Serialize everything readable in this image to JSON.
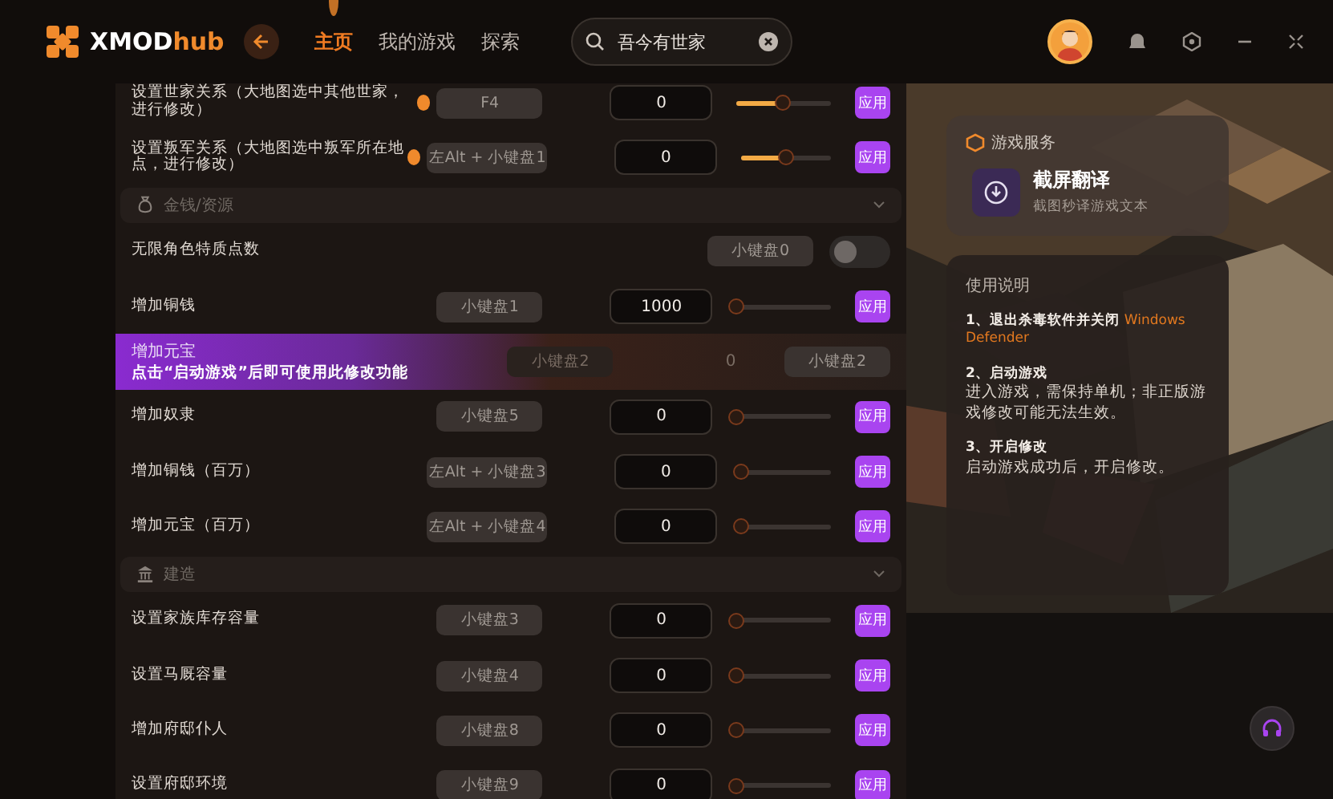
{
  "header": {
    "brand_main": "XMOD",
    "brand_accent": "hub",
    "nav": [
      {
        "label": "主页",
        "selected": true
      },
      {
        "label": "我的游戏",
        "selected": false
      },
      {
        "label": "探索",
        "selected": false
      }
    ],
    "search": {
      "value": "吾今有世家"
    }
  },
  "sections": [
    {
      "rows": [
        {
          "kind": "slider",
          "label": "设置世家关系（大地图选中其他世家，进行修改）",
          "info": true,
          "key": "F4",
          "value": "0",
          "level": 0.5,
          "button": "应用"
        },
        {
          "kind": "slider",
          "label": "设置叛军关系（大地图选中叛军所在地点，进行修改）",
          "info": true,
          "key": "左Alt + 小键盘1",
          "value": "0",
          "level": 0.5,
          "button": "应用"
        }
      ]
    },
    {
      "title": "金钱/资源",
      "rows": [
        {
          "kind": "toggle",
          "label": "无限角色特质点数",
          "key": "小键盘0",
          "on": false
        },
        {
          "kind": "slider",
          "label": "增加铜钱",
          "info": false,
          "key": "小键盘1",
          "value": "1000",
          "level": 0,
          "button": "应用"
        },
        {
          "kind": "locked",
          "label": "增加元宝",
          "notice": "点击“启动游戏”后即可使用此修改功能",
          "key": "小键盘2",
          "value": "0",
          "key2": "小键盘2"
        },
        {
          "kind": "slider",
          "label": "增加奴隶",
          "info": false,
          "key": "小键盘5",
          "value": "0",
          "level": 0,
          "button": "应用"
        },
        {
          "kind": "slider",
          "label": "增加铜钱（百万）",
          "info": false,
          "key": "左Alt + 小键盘3",
          "value": "0",
          "level": 0,
          "button": "应用"
        },
        {
          "kind": "slider",
          "label": "增加元宝（百万）",
          "info": false,
          "key": "左Alt + 小键盘4",
          "value": "0",
          "level": 0,
          "button": "应用"
        }
      ]
    },
    {
      "title": "建造",
      "rows": [
        {
          "kind": "slider",
          "label": "设置家族库存容量",
          "info": false,
          "key": "小键盘3",
          "value": "0",
          "level": 0,
          "button": "应用"
        },
        {
          "kind": "slider",
          "label": "设置马厩容量",
          "info": false,
          "key": "小键盘4",
          "value": "0",
          "level": 0,
          "button": "应用"
        },
        {
          "kind": "slider",
          "label": "增加府邸仆人",
          "info": false,
          "key": "小键盘8",
          "value": "0",
          "level": 0,
          "button": "应用"
        },
        {
          "kind": "slider",
          "label": "设置府邸环境",
          "info": false,
          "key": "小键盘9",
          "value": "0",
          "level": 0,
          "button": "应用"
        }
      ]
    }
  ],
  "service": {
    "title": "游戏服务",
    "app_title": "截屏翻译",
    "app_subtitle": "截图秒译游戏文本"
  },
  "guide": {
    "title": "使用说明",
    "steps": [
      {
        "heading": "1、退出杀毒软件并关闭",
        "highlight": "Windows Defender"
      },
      {
        "heading": "2、启动游戏",
        "body": "进入游戏，需保持单机；非正版游戏修改可能无法生效。"
      },
      {
        "heading": "3、开启修改",
        "body": "启动游戏成功后，开启修改。"
      }
    ]
  }
}
